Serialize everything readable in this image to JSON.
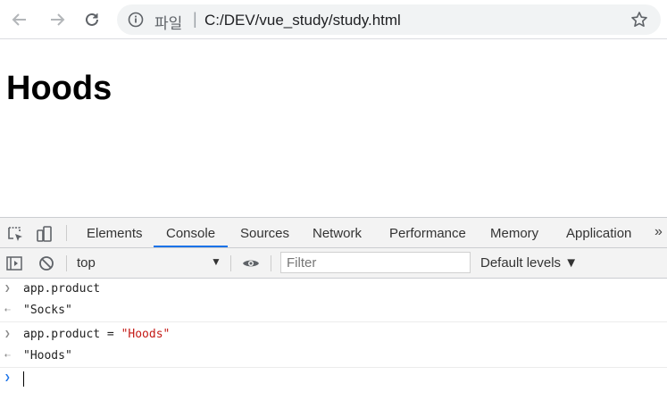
{
  "browser": {
    "scheme_label": "파일",
    "separator": "|",
    "url": "C:/DEV/vue_study/study.html"
  },
  "page": {
    "heading": "Hoods"
  },
  "devtools": {
    "tabs": [
      {
        "label": "Elements"
      },
      {
        "label": "Console",
        "active": true
      },
      {
        "label": "Sources"
      },
      {
        "label": "Network"
      },
      {
        "label": "Performance"
      },
      {
        "label": "Memory"
      },
      {
        "label": "Application"
      }
    ],
    "more_label": "»",
    "context": "top",
    "filter_placeholder": "Filter",
    "levels_label": "Default levels ▼",
    "console": {
      "input1": "app.product",
      "output1": "\"Socks\"",
      "input2_expr": "app.product = ",
      "input2_value": "\"Hoods\"",
      "output2": "\"Hoods\""
    }
  },
  "colors": {
    "accent": "#1a73e8",
    "string": "#c41a16"
  }
}
